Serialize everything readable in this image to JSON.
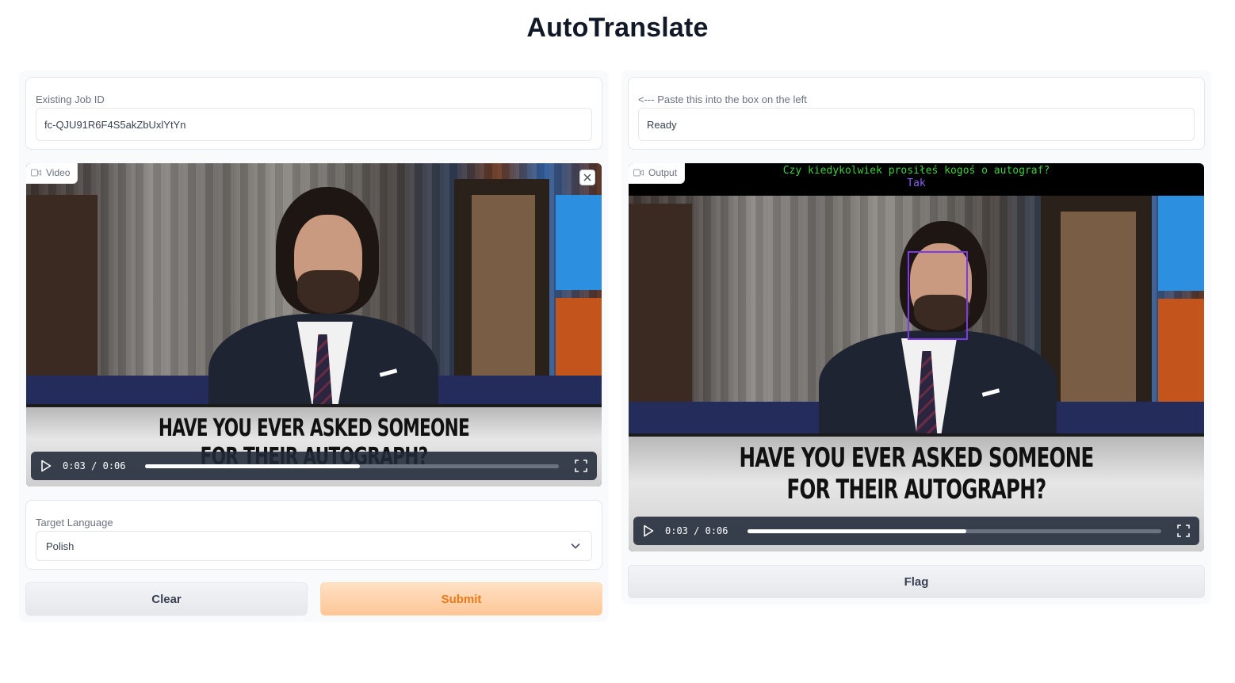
{
  "app": {
    "title": "AutoTranslate"
  },
  "left": {
    "job_id": {
      "label": "Existing Job ID",
      "value": "fc-QJU91R6F4S5akZbUxlYtYn"
    },
    "video": {
      "tag": "Video",
      "icon": "video-camera-icon",
      "banner_line1": "HAVE YOU EVER ASKED SOMEONE",
      "banner_line2": "FOR THEIR AUTOGRAPH?",
      "current_time": "0:03",
      "separator": "/",
      "duration": "0:06",
      "progress": 0.52
    },
    "target_language": {
      "label": "Target Language",
      "value": "Polish"
    },
    "buttons": {
      "clear": "Clear",
      "submit": "Submit"
    }
  },
  "right": {
    "status": {
      "label": "<--- Paste this into the box on the left",
      "value": "Ready"
    },
    "output": {
      "tag": "Output",
      "icon": "video-camera-icon",
      "subtitle_line1": "Czy kiedykolwiek prosiłeś kogoś o autograf?",
      "subtitle_line2": "Tak",
      "banner_line1": "HAVE YOU EVER ASKED SOMEONE",
      "banner_line2": "FOR THEIR AUTOGRAPH?",
      "current_time": "0:03",
      "separator": "/",
      "duration": "0:06",
      "progress": 0.53
    },
    "buttons": {
      "flag": "Flag"
    }
  },
  "colors": {
    "accent": "#ea7a1a",
    "primary_button": "#fdc696",
    "face_box": "#7c3aed",
    "subtitle_green": "#3ccf3c",
    "subtitle_purple": "#8b5cf6"
  }
}
